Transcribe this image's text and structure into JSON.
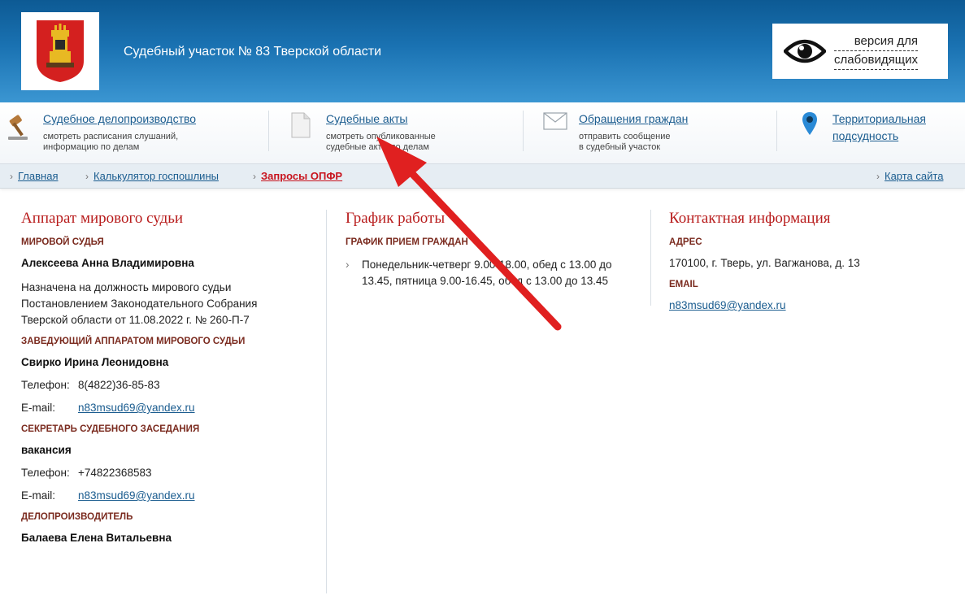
{
  "header": {
    "title": "Судебный участок № 83 Тверской области",
    "vision_line1": "версия для",
    "vision_line2": "слабовидящих"
  },
  "nav": [
    {
      "label": "Судебное делопроизводство",
      "desc1": "смотреть расписания слушаний,",
      "desc2": "информацию по делам",
      "icon": "gavel-icon"
    },
    {
      "label": "Судебные акты",
      "desc1": "смотреть опубликованные",
      "desc2": "судебные акты по делам",
      "icon": "document-icon"
    },
    {
      "label": "Обращения граждан",
      "desc1": "отправить сообщение",
      "desc2": "в судебный участок",
      "icon": "envelope-icon"
    },
    {
      "label": "Территориальная",
      "label2": "подсудность",
      "icon": "map-pin-icon"
    }
  ],
  "breadcrumbs": {
    "items": [
      "Главная",
      "Калькулятор госпошлины",
      "Запросы ОПФР"
    ],
    "sitemap": "Карта сайта"
  },
  "apparatus": {
    "title": "Аппарат мирового судьи",
    "judge_heading": "МИРОВОЙ СУДЬЯ",
    "judge_name": "Алексеева Анна Владимировна",
    "judge_appointment": "Назначена на должность мирового судьи Постановлением Законодательного Собрания Тверской области от 11.08.2022 г. № 260-П-7",
    "head_heading": "ЗАВЕДУЮЩИЙ АППАРАТОМ МИРОВОГО СУДЬИ",
    "head_name": "Свирко Ирина Леонидовна",
    "phone_label": "Телефон:",
    "head_phone": "8(4822)36-85-83",
    "email_label": "E-mail:",
    "head_email": "n83msud69@yandex.ru",
    "secretary_heading": "СЕКРЕТАРЬ СУДЕБНОГО ЗАСЕДАНИЯ",
    "secretary_name": "вакансия",
    "secretary_phone": "+74822368583",
    "secretary_email": "n83msud69@yandex.ru",
    "clerk_heading": "ДЕЛОПРОИЗВОДИТЕЛЬ",
    "clerk_name": "Балаева Елена Витальевна"
  },
  "schedule": {
    "title": "График работы",
    "heading": "ГРАФИК ПРИЕМ ГРАЖДАН",
    "text": "Понедельник-четверг 9.00-18.00, обед с 13.00 до 13.45, пятница 9.00-16.45, обед с 13.00 до 13.45"
  },
  "contacts": {
    "title": "Контактная информация",
    "address_heading": "АДРЕС",
    "address": "170100, г. Тверь, ул. Вагжанова, д. 13",
    "email_heading": "EMAIL",
    "email": "n83msud69@yandex.ru"
  },
  "colors": {
    "header_blue": "#1a72b2",
    "title_red": "#b81c1c",
    "link_blue": "#1a5c8f",
    "annotation_arrow": "#e02020"
  }
}
